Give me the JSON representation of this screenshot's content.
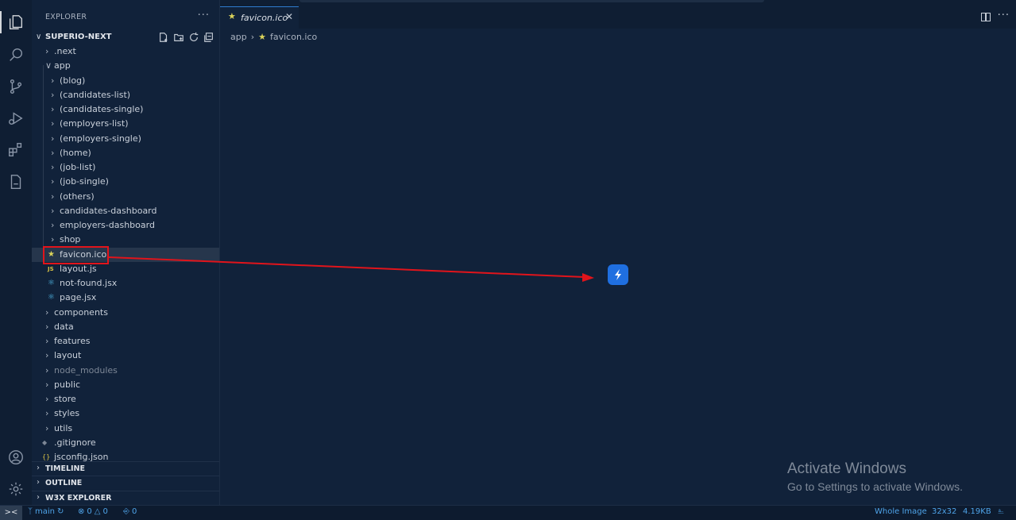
{
  "explorer": {
    "header": "EXPLORER",
    "more": "···",
    "project_name": "SUPERIO-NEXT",
    "tree": [
      {
        "label": ".next",
        "level": 1,
        "type": "folder",
        "expanded": false,
        "dim": false
      },
      {
        "label": "app",
        "level": 1,
        "type": "folder",
        "expanded": true,
        "dim": false
      },
      {
        "label": "(blog)",
        "level": 2,
        "type": "folder",
        "expanded": false,
        "dim": false
      },
      {
        "label": "(candidates-list)",
        "level": 2,
        "type": "folder",
        "expanded": false,
        "dim": false
      },
      {
        "label": "(candidates-single)",
        "level": 2,
        "type": "folder",
        "expanded": false,
        "dim": false
      },
      {
        "label": "(employers-list)",
        "level": 2,
        "type": "folder",
        "expanded": false,
        "dim": false
      },
      {
        "label": "(employers-single)",
        "level": 2,
        "type": "folder",
        "expanded": false,
        "dim": false
      },
      {
        "label": "(home)",
        "level": 2,
        "type": "folder",
        "expanded": false,
        "dim": false
      },
      {
        "label": "(job-list)",
        "level": 2,
        "type": "folder",
        "expanded": false,
        "dim": false
      },
      {
        "label": "(job-single)",
        "level": 2,
        "type": "folder",
        "expanded": false,
        "dim": false
      },
      {
        "label": "(others)",
        "level": 2,
        "type": "folder",
        "expanded": false,
        "dim": false
      },
      {
        "label": "candidates-dashboard",
        "level": 2,
        "type": "folder",
        "expanded": false,
        "dim": false
      },
      {
        "label": "employers-dashboard",
        "level": 2,
        "type": "folder",
        "expanded": false,
        "dim": false
      },
      {
        "label": "shop",
        "level": 2,
        "type": "folder",
        "expanded": false,
        "dim": false
      },
      {
        "label": "favicon.ico",
        "level": 2,
        "type": "favicon",
        "selected": true,
        "dim": false
      },
      {
        "label": "layout.js",
        "level": 2,
        "type": "js",
        "dim": false
      },
      {
        "label": "not-found.jsx",
        "level": 2,
        "type": "react",
        "dim": false
      },
      {
        "label": "page.jsx",
        "level": 2,
        "type": "react",
        "dim": false
      },
      {
        "label": "components",
        "level": 1,
        "type": "folder",
        "expanded": false,
        "dim": false
      },
      {
        "label": "data",
        "level": 1,
        "type": "folder",
        "expanded": false,
        "dim": false
      },
      {
        "label": "features",
        "level": 1,
        "type": "folder",
        "expanded": false,
        "dim": false
      },
      {
        "label": "layout",
        "level": 1,
        "type": "folder",
        "expanded": false,
        "dim": false
      },
      {
        "label": "node_modules",
        "level": 1,
        "type": "folder",
        "expanded": false,
        "dim": true
      },
      {
        "label": "public",
        "level": 1,
        "type": "folder",
        "expanded": false,
        "dim": false
      },
      {
        "label": "store",
        "level": 1,
        "type": "folder",
        "expanded": false,
        "dim": false
      },
      {
        "label": "styles",
        "level": 1,
        "type": "folder",
        "expanded": false,
        "dim": false
      },
      {
        "label": "utils",
        "level": 1,
        "type": "folder",
        "expanded": false,
        "dim": false
      },
      {
        "label": ".gitignore",
        "level": 1,
        "type": "git",
        "dim": false
      },
      {
        "label": "jsconfig.json",
        "level": 1,
        "type": "json",
        "dim": false
      }
    ],
    "panels": [
      "TIMELINE",
      "OUTLINE",
      "W3X EXPLORER"
    ]
  },
  "editor": {
    "tab_label": "favicon.ico",
    "breadcrumb_root": "app",
    "breadcrumb_file": "favicon.ico"
  },
  "watermark": {
    "title": "Activate Windows",
    "subtitle": "Go to Settings to activate Windows."
  },
  "statusbar": {
    "branch": "main",
    "errors": "0",
    "warnings": "0",
    "ports": "0",
    "image_mode": "Whole Image",
    "image_size": "32x32",
    "file_size": "4.19KB"
  },
  "colors": {
    "background": "#11223a",
    "highlight": "#e1141b",
    "accent": "#1f6fe0",
    "status_text": "#4ea3e8"
  }
}
